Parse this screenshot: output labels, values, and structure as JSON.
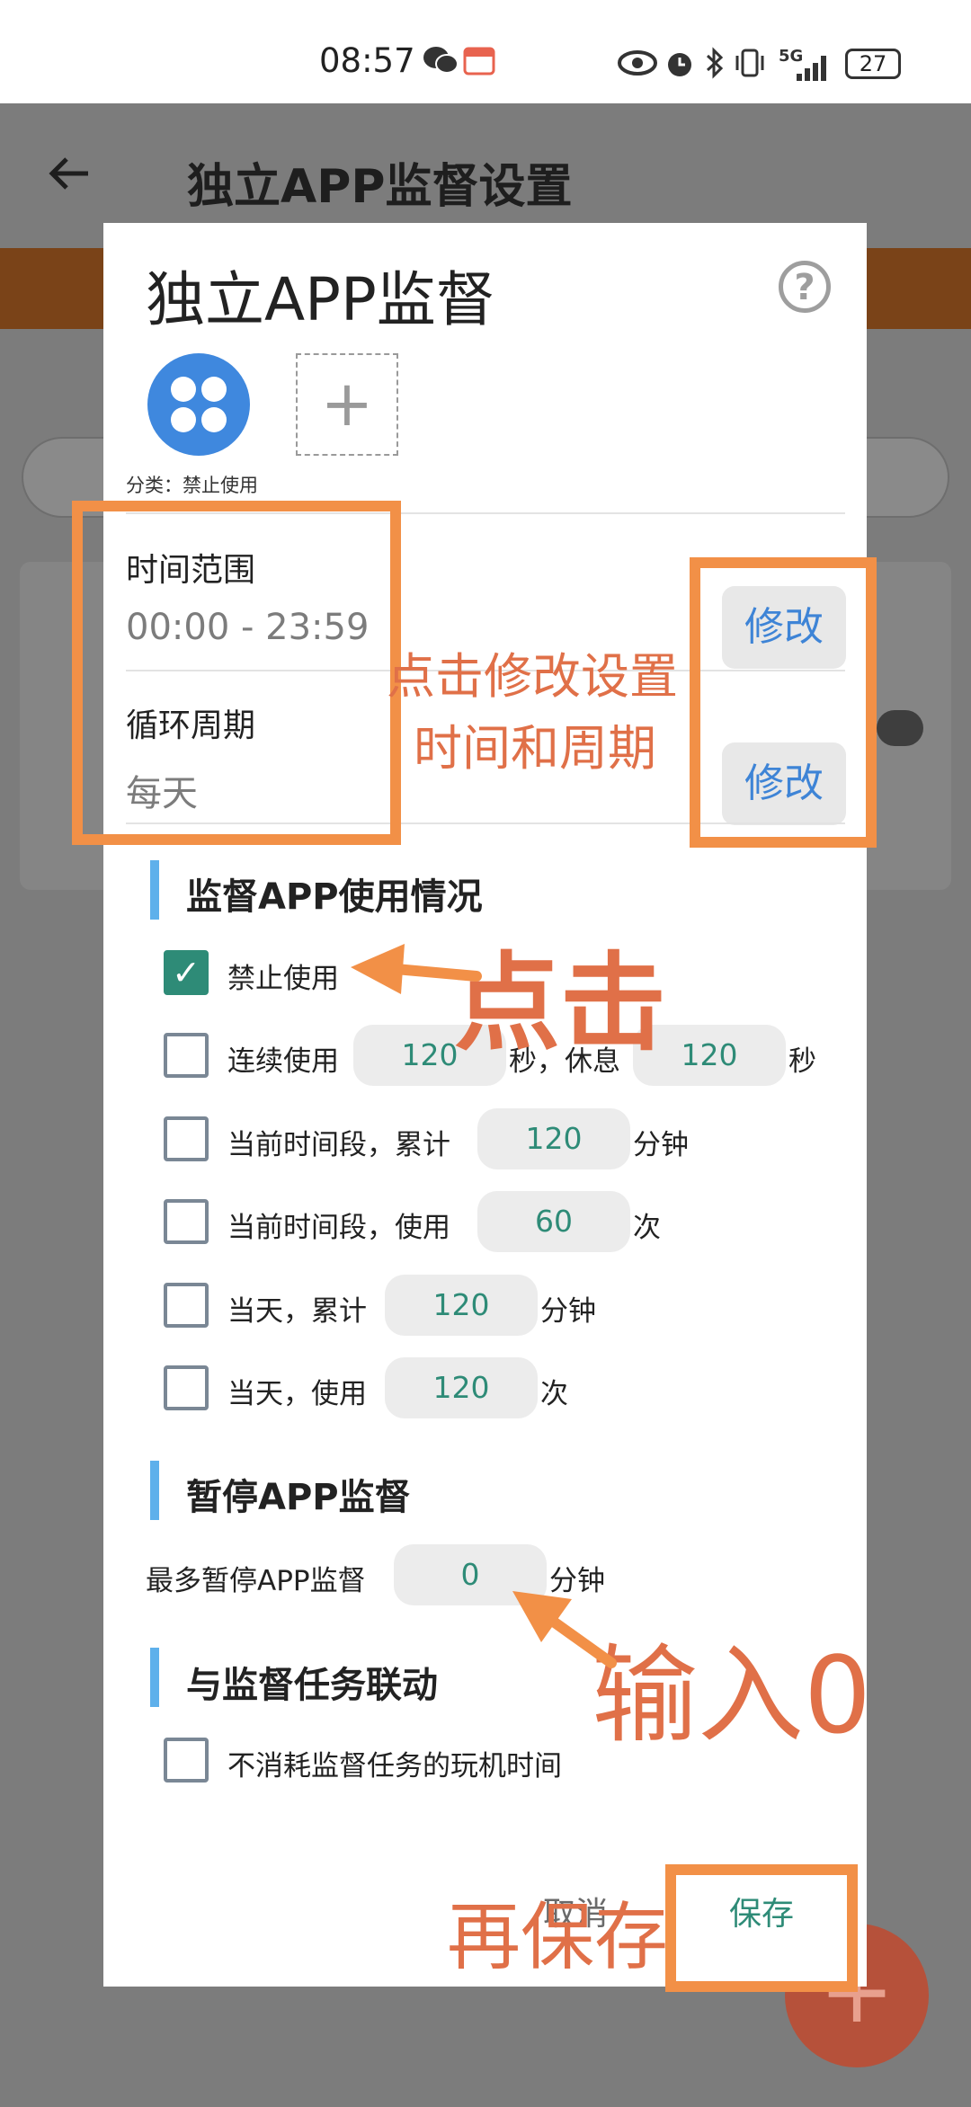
{
  "status_bar": {
    "time": "08:57",
    "battery": "27",
    "network": "5G"
  },
  "background": {
    "title": "独立APP监督设置",
    "back_icon": "arrow-left-icon",
    "fab_icon": "plus-icon"
  },
  "dialog": {
    "title": "独立APP监督",
    "help_icon": "question-circle-icon",
    "category_label": "分类：禁止使用",
    "time_range": {
      "label": "时间范围",
      "value": "00:00 - 23:59",
      "edit": "修改"
    },
    "cycle": {
      "label": "循环周期",
      "value": "每天",
      "edit": "修改"
    },
    "monitor_section": {
      "title": "监督APP使用情况",
      "ban": {
        "label": "禁止使用",
        "checked": true
      },
      "continuous": {
        "prefix": "连续使用",
        "value1": "120",
        "mid": "秒，休息",
        "value2": "120",
        "suffix": "秒"
      },
      "period_total": {
        "prefix": "当前时间段，累计",
        "value": "120",
        "suffix": "分钟"
      },
      "period_count": {
        "prefix": "当前时间段，使用",
        "value": "60",
        "suffix": "次"
      },
      "day_total": {
        "prefix": "当天，累计",
        "value": "120",
        "suffix": "分钟"
      },
      "day_count": {
        "prefix": "当天，使用",
        "value": "120",
        "suffix": "次"
      }
    },
    "pause_section": {
      "title": "暂停APP监督",
      "prefix": "最多暂停APP监督",
      "value": "0",
      "suffix": "分钟"
    },
    "link_section": {
      "title": "与监督任务联动",
      "option": "不消耗监督任务的玩机时间"
    },
    "buttons": {
      "cancel": "取消",
      "save": "保存"
    }
  },
  "annotations": {
    "edit_note_line1": "点击修改设置",
    "edit_note_line2": "时间和周期",
    "click_note": "点击",
    "input_note": "输入0",
    "save_note": "再保存"
  },
  "colors": {
    "accent": "#2e8b77",
    "link": "#3e84d6",
    "annotation": "#f29047",
    "section_bar": "#5eb0eb"
  }
}
